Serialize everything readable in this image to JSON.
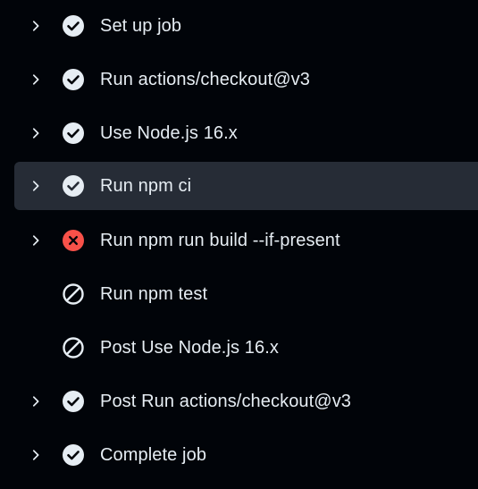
{
  "colors": {
    "background": "#010409",
    "selected_row": "#262c36",
    "text": "#e6edf3",
    "success_icon": "#e6edf3",
    "failure_icon": "#f85149",
    "skipped_icon": "#e6edf3"
  },
  "steps": [
    {
      "label": "Set up job",
      "status": "success",
      "icon": "check-circle-icon",
      "expandable": true
    },
    {
      "label": "Run actions/checkout@v3",
      "status": "success",
      "icon": "check-circle-icon",
      "expandable": true
    },
    {
      "label": "Use Node.js 16.x",
      "status": "success",
      "icon": "check-circle-icon",
      "expandable": true
    },
    {
      "label": "Run npm ci",
      "status": "success",
      "icon": "check-circle-icon",
      "expandable": true,
      "selected": true
    },
    {
      "label": "Run npm run build --if-present",
      "status": "failure",
      "icon": "x-circle-icon",
      "expandable": true
    },
    {
      "label": "Run npm test",
      "status": "skipped",
      "icon": "skip-icon",
      "expandable": false
    },
    {
      "label": "Post Use Node.js 16.x",
      "status": "skipped",
      "icon": "skip-icon",
      "expandable": false
    },
    {
      "label": "Post Run actions/checkout@v3",
      "status": "success",
      "icon": "check-circle-icon",
      "expandable": true
    },
    {
      "label": "Complete job",
      "status": "success",
      "icon": "check-circle-icon",
      "expandable": true
    }
  ]
}
